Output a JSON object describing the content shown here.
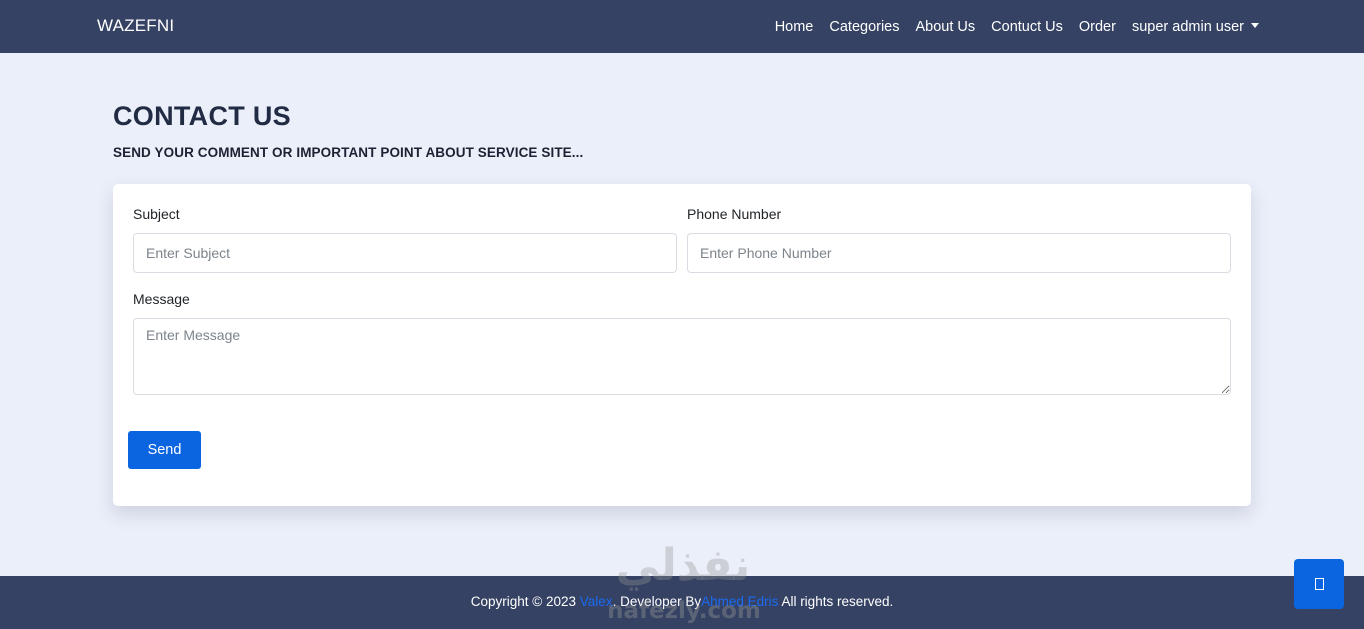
{
  "navbar": {
    "brand": "WAZEFNI",
    "links": [
      "Home",
      "Categories",
      "About Us",
      "Contuct Us",
      "Order"
    ],
    "user_menu": "super admin user"
  },
  "page": {
    "title": "CONTACT US",
    "subtitle": "SEND YOUR COMMENT OR IMPORTANT POINT ABOUT SERVICE SITE..."
  },
  "form": {
    "subject_label": "Subject",
    "subject_placeholder": "Enter Subject",
    "phone_label": "Phone Number",
    "phone_placeholder": "Enter Phone Number",
    "message_label": "Message",
    "message_placeholder": "Enter Message",
    "send_label": "Send"
  },
  "footer": {
    "prefix": "Copyright © 2023",
    "site_link": "Valex",
    "developer_text": ". Developer By",
    "developer_link": "Ahmed Edris",
    "suffix": "All rights reserved."
  },
  "watermark": {
    "arabic": "نفذلي",
    "latin": "nafezly.com"
  },
  "colors": {
    "navbar_bg": "#354263",
    "page_bg": "#ebeff9",
    "accent": "#0b64e0",
    "link": "#1b6bf2"
  },
  "icons": {
    "scroll_top": "square-glyph-icon",
    "user_menu": "caret-down-icon"
  }
}
